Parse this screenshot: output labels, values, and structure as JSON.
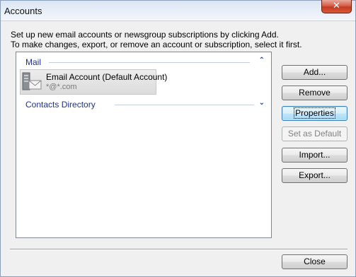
{
  "window": {
    "title": "Accounts",
    "close_glyph": "✕"
  },
  "description": {
    "line1": "Set up new email accounts or newsgroup subscriptions by clicking Add.",
    "line2": "To make changes, export, or remove an account or subscription, select it first."
  },
  "groups": {
    "mail": {
      "label": "Mail",
      "chevron": "⌃",
      "state": "expanded"
    },
    "contacts": {
      "label": "Contacts Directory",
      "chevron": "⌄",
      "state": "collapsed"
    }
  },
  "account": {
    "name": "Email Account (Default Account)",
    "address": "*@*.com",
    "icon": "mail-server-icon"
  },
  "buttons": {
    "add": "Add...",
    "remove": "Remove",
    "properties": "Properties",
    "set_default": "Set as Default",
    "import": "Import...",
    "export": "Export...",
    "close": "Close"
  },
  "colors": {
    "group_label": "#1e3287",
    "focus_border": "#3c7fb1",
    "close_button": "#c6391f"
  }
}
